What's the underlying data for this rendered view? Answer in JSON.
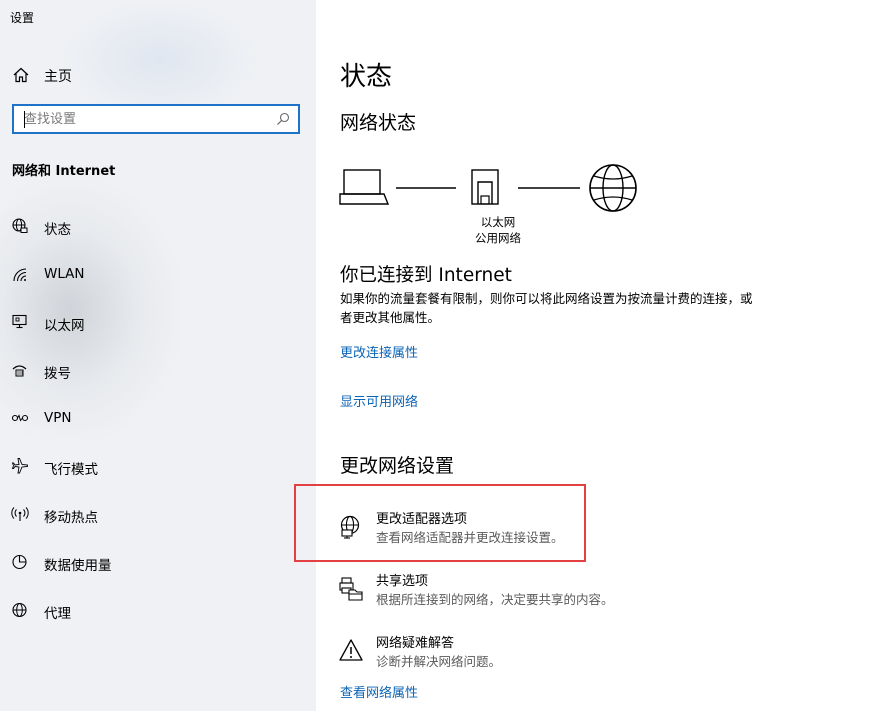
{
  "window": {
    "title": "设置"
  },
  "sidebar": {
    "home_label": "主页",
    "search_placeholder": "查找设置",
    "section_heading": "网络和 Internet",
    "items": [
      {
        "label": "状态",
        "icon": "status-globe-icon"
      },
      {
        "label": "WLAN",
        "icon": "wifi-icon"
      },
      {
        "label": "以太网",
        "icon": "ethernet-icon"
      },
      {
        "label": "拨号",
        "icon": "dialup-icon"
      },
      {
        "label": "VPN",
        "icon": "vpn-icon"
      },
      {
        "label": "飞行模式",
        "icon": "airplane-icon"
      },
      {
        "label": "移动热点",
        "icon": "hotspot-icon"
      },
      {
        "label": "数据使用量",
        "icon": "data-usage-icon"
      },
      {
        "label": "代理",
        "icon": "proxy-globe-icon"
      }
    ]
  },
  "main": {
    "title": "状态",
    "network_status_heading": "网络状态",
    "diagram": {
      "adapter_name": "以太网",
      "network_type": "公用网络"
    },
    "connected_title": "你已连接到 Internet",
    "connected_desc": "如果你的流量套餐有限制，则你可以将此网络设置为按流量计费的连接，或者更改其他属性。",
    "link_change_connection": "更改连接属性",
    "link_show_networks": "显示可用网络",
    "change_settings_heading": "更改网络设置",
    "options": [
      {
        "title": "更改适配器选项",
        "desc": "查看网络适配器并更改连接设置。",
        "icon": "adapter-globe-icon"
      },
      {
        "title": "共享选项",
        "desc": "根据所连接到的网络，决定要共享的内容。",
        "icon": "sharing-printer-icon"
      },
      {
        "title": "网络疑难解答",
        "desc": "诊断并解决网络问题。",
        "icon": "warning-triangle-icon"
      }
    ],
    "link_view_properties": "查看网络属性"
  },
  "colors": {
    "accent": "#0b63b6",
    "highlight_border": "#e34141",
    "search_border": "#1e73c8"
  }
}
